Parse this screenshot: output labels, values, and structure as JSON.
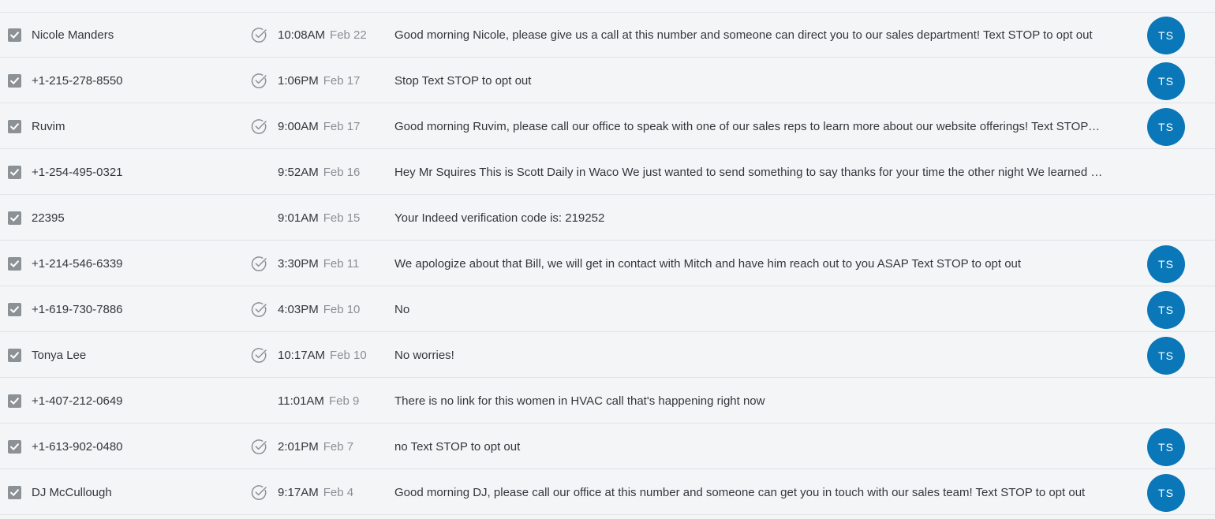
{
  "colors": {
    "background": "#f4f5f7",
    "divider": "#e1e3e6",
    "checkbox": "#8c9196",
    "avatar": "#0a77b8",
    "date_text": "#8a8f94"
  },
  "icons": {
    "checkbox": "checkbox-checked-icon",
    "delivered": "check-circle-icon"
  },
  "conversations": [
    {
      "checked": true,
      "contact": "Nicole Manders",
      "delivered": true,
      "time": "10:08AM",
      "date": "Feb 22",
      "message": "Good morning Nicole, please give us a call at this number and someone can direct you to our sales department! Text STOP to opt out",
      "avatar": "TS"
    },
    {
      "checked": true,
      "contact": "+1-215-278-8550",
      "delivered": true,
      "time": "1:06PM",
      "date": "Feb 17",
      "message": "Stop Text STOP to opt out",
      "avatar": "TS"
    },
    {
      "checked": true,
      "contact": "Ruvim",
      "delivered": true,
      "time": "9:00AM",
      "date": "Feb 17",
      "message": "Good morning Ruvim, please call our office to speak with one of our sales reps to learn more about our website offerings! Text STOP to o...",
      "avatar": "TS"
    },
    {
      "checked": true,
      "contact": "+1-254-495-0321",
      "delivered": false,
      "time": "9:52AM",
      "date": "Feb 16",
      "message": "Hey Mr Squires This is Scott Daily in Waco We just wanted to send something to say thanks for your time the other night We learned a lo...",
      "avatar": ""
    },
    {
      "checked": true,
      "contact": "22395",
      "delivered": false,
      "time": "9:01AM",
      "date": "Feb 15",
      "message": "Your Indeed verification code is: 219252",
      "avatar": ""
    },
    {
      "checked": true,
      "contact": "+1-214-546-6339",
      "delivered": true,
      "time": "3:30PM",
      "date": "Feb 11",
      "message": "We apologize about that Bill, we will get in contact with Mitch and have him reach out to you ASAP Text STOP to opt out",
      "avatar": "TS"
    },
    {
      "checked": true,
      "contact": "+1-619-730-7886",
      "delivered": true,
      "time": "4:03PM",
      "date": "Feb 10",
      "message": "No",
      "avatar": "TS"
    },
    {
      "checked": true,
      "contact": "Tonya Lee",
      "delivered": true,
      "time": "10:17AM",
      "date": "Feb 10",
      "message": "No worries!",
      "avatar": "TS"
    },
    {
      "checked": true,
      "contact": "+1-407-212-0649",
      "delivered": false,
      "time": "11:01AM",
      "date": "Feb 9",
      "message": "There is no link for this women in HVAC call that's happening right now",
      "avatar": ""
    },
    {
      "checked": true,
      "contact": "+1-613-902-0480",
      "delivered": true,
      "time": "2:01PM",
      "date": "Feb 7",
      "message": "no Text STOP to opt out",
      "avatar": "TS"
    },
    {
      "checked": true,
      "contact": "DJ McCullough",
      "delivered": true,
      "time": "9:17AM",
      "date": "Feb 4",
      "message": "Good morning DJ, please call our office at this number and someone can get you in touch with our sales team! Text STOP to opt out",
      "avatar": "TS"
    }
  ]
}
